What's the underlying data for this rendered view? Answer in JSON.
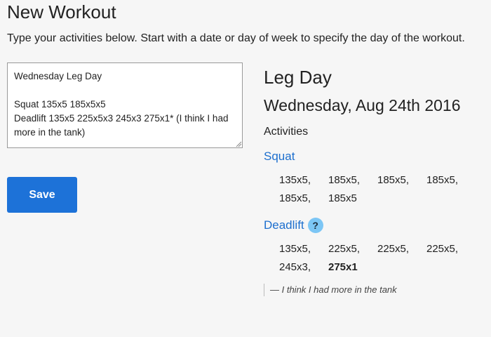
{
  "page": {
    "title": "New Workout",
    "instructions": "Type your activities below. Start with a date or day of week to specify the day of the workout."
  },
  "editor": {
    "value": "Wednesday Leg Day\n\nSquat 135x5 185x5x5\nDeadlift 135x5 225x5x3 245x3 275x1* (I think I had more in the tank)"
  },
  "actions": {
    "save_label": "Save"
  },
  "preview": {
    "workout_name": "Leg Day",
    "workout_date": "Wednesday, Aug 24th 2016",
    "activities_label": "Activities",
    "exercises": [
      {
        "name": "Squat",
        "sets": [
          "135x5,",
          "185x5,",
          "185x5,",
          "185x5,",
          "185x5,",
          "185x5"
        ]
      },
      {
        "name": "Deadlift",
        "help_icon": "question-mark-icon",
        "help_label": "?",
        "sets": [
          "135x5,",
          "225x5,",
          "225x5,",
          "225x5,",
          "245x3,",
          "275x1"
        ],
        "note": "— I think I had more in the tank"
      }
    ]
  },
  "colors": {
    "accent": "#1d72d8",
    "link": "#1d6fce",
    "help_badge": "#7cc6f5",
    "background": "#f6f6f6"
  }
}
